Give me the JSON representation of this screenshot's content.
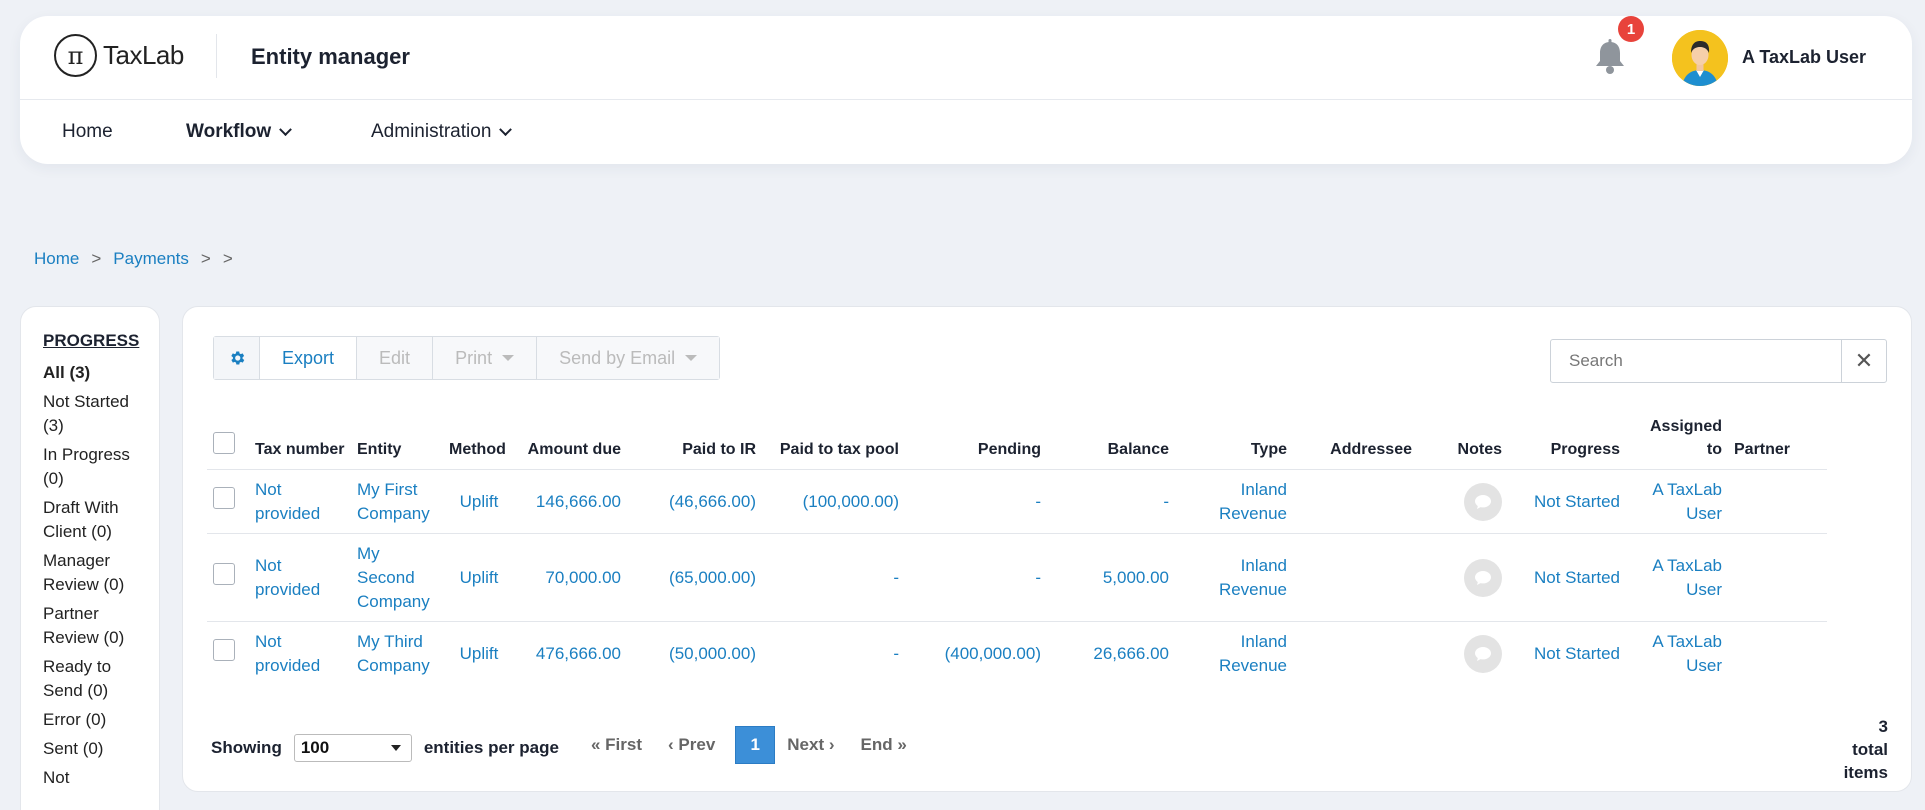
{
  "header": {
    "logo_glyph": "π",
    "logo_text": "TaxLab",
    "app_title": "Entity manager",
    "notification_count": "1",
    "user_name": "A TaxLab User"
  },
  "nav": {
    "home": "Home",
    "workflow": "Workflow",
    "administration": "Administration"
  },
  "breadcrumb": {
    "items": [
      "Home",
      "Payments"
    ],
    "separator": ">"
  },
  "progress": {
    "title": "PROGRESS",
    "items": [
      "All (3)",
      "Not Started (3)",
      "In Progress (0)",
      "Draft With Client (0)",
      "Manager Review (0)",
      "Partner Review (0)",
      "Ready to Send (0)",
      "Error (0)",
      "Sent (0)",
      "Not"
    ]
  },
  "toolbar": {
    "export": "Export",
    "edit": "Edit",
    "print": "Print",
    "send_by_email": "Send by Email"
  },
  "search": {
    "placeholder": "Search",
    "clear": "✕"
  },
  "table": {
    "headers": {
      "tax_number": "Tax number",
      "entity": "Entity",
      "method": "Method",
      "amount_due": "Amount due",
      "paid_to_ir": "Paid to IR",
      "paid_to_tax_pool": "Paid to tax pool",
      "pending": "Pending",
      "balance": "Balance",
      "type": "Type",
      "addressee": "Addressee",
      "notes": "Notes",
      "progress": "Progress",
      "assigned_to": "Assigned to",
      "partner": "Partner"
    },
    "rows": [
      {
        "tax_number": "Not provided",
        "entity": "My First Company",
        "method": "Uplift",
        "amount_due": "146,666.00",
        "paid_to_ir": "(46,666.00)",
        "paid_to_tax_pool": "(100,000.00)",
        "pending": "-",
        "balance": "-",
        "type": "Inland Revenue",
        "addressee": "",
        "progress": "Not Started",
        "assigned_to": "A TaxLab User",
        "partner": ""
      },
      {
        "tax_number": "Not provided",
        "entity": "My Second Company",
        "method": "Uplift",
        "amount_due": "70,000.00",
        "paid_to_ir": "(65,000.00)",
        "paid_to_tax_pool": "-",
        "pending": "-",
        "balance": "5,000.00",
        "type": "Inland Revenue",
        "addressee": "",
        "progress": "Not Started",
        "assigned_to": "A TaxLab User",
        "partner": ""
      },
      {
        "tax_number": "Not provided",
        "entity": "My Third Company",
        "method": "Uplift",
        "amount_due": "476,666.00",
        "paid_to_ir": "(50,000.00)",
        "paid_to_tax_pool": "-",
        "pending": "(400,000.00)",
        "balance": "26,666.00",
        "type": "Inland Revenue",
        "addressee": "",
        "progress": "Not Started",
        "assigned_to": "A TaxLab User",
        "partner": ""
      }
    ]
  },
  "footer": {
    "showing": "Showing",
    "per_page_value": "100",
    "per_page_suffix": "entities per page",
    "first": "« First",
    "prev": "‹ Prev",
    "current_page": "1",
    "next": "Next ›",
    "end": "End »",
    "total_count": "3",
    "total_word1": "total",
    "total_word2": "items"
  },
  "colors": {
    "link": "#1a7fc1",
    "badge": "#e8433b",
    "avatar_bg": "#f4c21e",
    "current_page": "#3c8fd8"
  }
}
